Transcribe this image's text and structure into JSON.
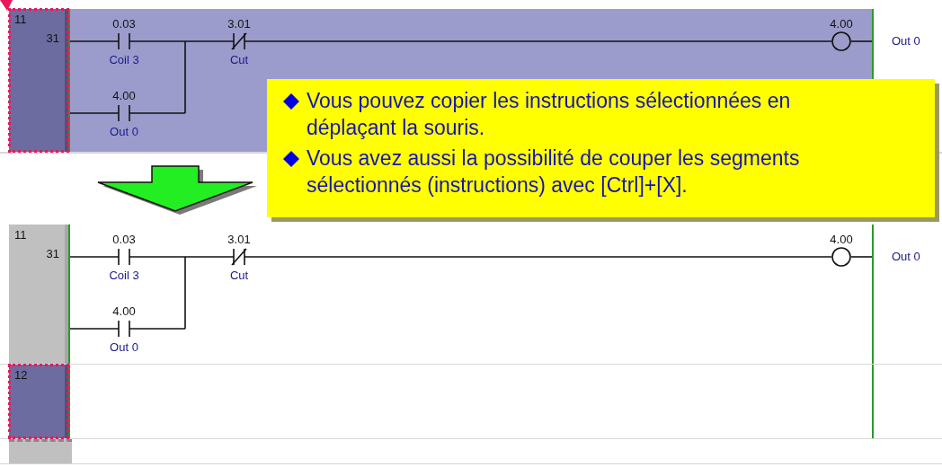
{
  "panels": [
    {
      "rungs": [
        {
          "number": "11",
          "step": "31",
          "selected": true,
          "main": [
            {
              "kind": "no",
              "address": "0.03",
              "label": "Coil 3"
            },
            {
              "kind": "nc",
              "address": "3.01",
              "label": "Cut"
            }
          ],
          "branch": [
            {
              "kind": "no",
              "address": "4.00",
              "label": "Out 0"
            }
          ],
          "output": {
            "address": "4.00",
            "label": "Out 0"
          }
        }
      ]
    },
    {
      "rungs": [
        {
          "number": "11",
          "step": "31",
          "selected": false,
          "main": [
            {
              "kind": "no",
              "address": "0.03",
              "label": "Coil 3"
            },
            {
              "kind": "nc",
              "address": "3.01",
              "label": "Cut"
            }
          ],
          "branch": [
            {
              "kind": "no",
              "address": "4.00",
              "label": "Out 0"
            }
          ],
          "output": {
            "address": "4.00",
            "label": "Out 0"
          }
        },
        {
          "number": "12",
          "selected": true
        }
      ]
    }
  ],
  "callout": {
    "bullets": [
      "Vous pouvez copier les instructions sélectionnées en déplaçant la souris.",
      "Vous avez aussi la possibilité de couper les segments sélectionnés (instructions) avec [Ctrl]+[X]."
    ]
  }
}
